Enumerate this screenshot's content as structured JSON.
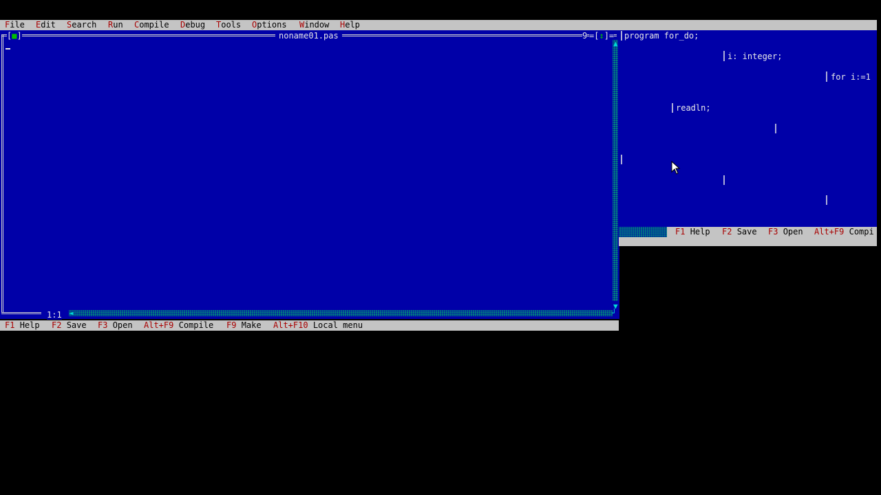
{
  "menu": {
    "items": [
      {
        "hotkey": "F",
        "rest": "ile"
      },
      {
        "hotkey": "E",
        "rest": "dit"
      },
      {
        "hotkey": "S",
        "rest": "earch"
      },
      {
        "hotkey": "R",
        "rest": "un"
      },
      {
        "hotkey": "C",
        "rest": "ompile"
      },
      {
        "hotkey": "D",
        "rest": "ebug"
      },
      {
        "hotkey": "T",
        "rest": "ools"
      },
      {
        "hotkey": "O",
        "rest": "ptions"
      },
      {
        "hotkey": "W",
        "rest": "indow"
      },
      {
        "hotkey": "H",
        "rest": "elp"
      }
    ]
  },
  "editor": {
    "filename": "noname01.pas",
    "close_box": "[■]",
    "window_number": "9",
    "zoom_box": "[↕]",
    "cursor_position": "1:1"
  },
  "status_bar": {
    "items": [
      {
        "key": "F1",
        "label": "Help"
      },
      {
        "key": "F2",
        "label": "Save"
      },
      {
        "key": "F3",
        "label": "Open"
      },
      {
        "key": "Alt+F9",
        "label": "Compile"
      },
      {
        "key": "F9",
        "label": "Make"
      },
      {
        "key": "Alt+F10",
        "label": "Local menu"
      }
    ]
  },
  "ghost_panel": {
    "code_lines": [
      "program for_do;",
      "i: integer;",
      "for i:=1",
      "readln;"
    ],
    "status_items": [
      {
        "key": "F1",
        "label": "Help"
      },
      {
        "key": "F2",
        "label": "Save"
      },
      {
        "key": "F3",
        "label": "Open"
      },
      {
        "key": "Alt+F9",
        "label": "Compi"
      }
    ]
  },
  "colors": {
    "editor_bg": "#0000a8",
    "bar_bg": "#c4c4c4",
    "hotkey": "#a80000",
    "scroll": "#008080"
  }
}
